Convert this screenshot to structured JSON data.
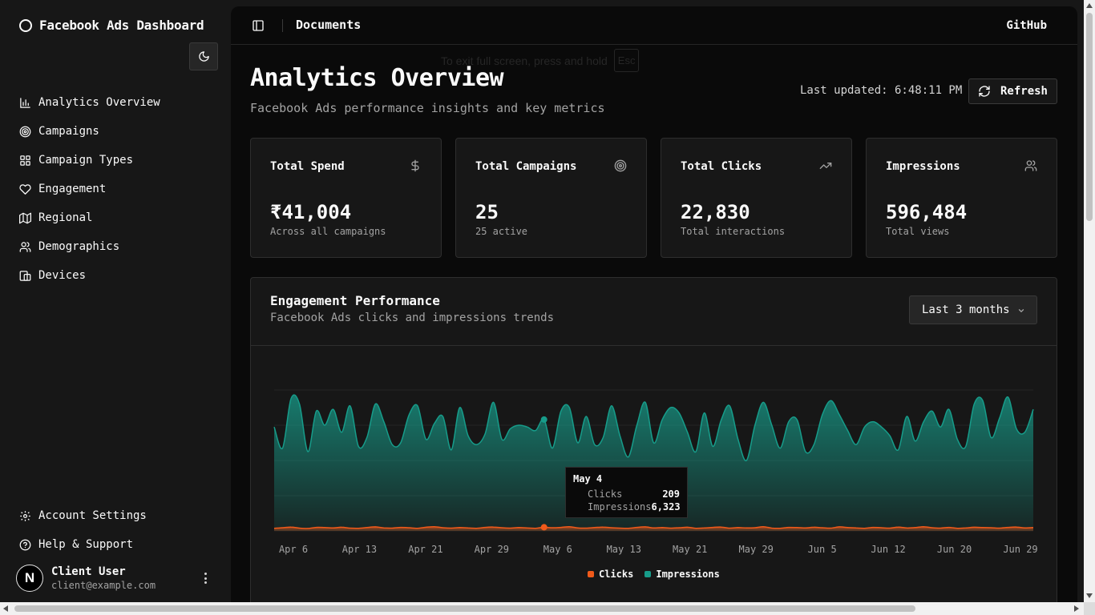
{
  "app": {
    "title": "Facebook Ads Dashboard"
  },
  "sidebar": {
    "items": [
      {
        "label": "Analytics Overview",
        "icon": "bar-chart-icon"
      },
      {
        "label": "Campaigns",
        "icon": "target-icon"
      },
      {
        "label": "Campaign Types",
        "icon": "grid-icon"
      },
      {
        "label": "Engagement",
        "icon": "heart-icon"
      },
      {
        "label": "Regional",
        "icon": "map-icon"
      },
      {
        "label": "Demographics",
        "icon": "users-icon"
      },
      {
        "label": "Devices",
        "icon": "devices-icon"
      }
    ],
    "bottom_items": [
      {
        "label": "Account Settings",
        "icon": "gear-icon"
      },
      {
        "label": "Help & Support",
        "icon": "help-circle-icon"
      }
    ],
    "user": {
      "avatar_letter": "N",
      "name": "Client User",
      "email": "client@example.com"
    }
  },
  "topbar": {
    "title": "Documents",
    "github": "GitHub"
  },
  "fullscreen_hint": {
    "text": "To exit full screen, press and hold",
    "key": "Esc"
  },
  "header": {
    "title": "Analytics Overview",
    "subtitle": "Facebook Ads performance insights and key metrics",
    "last_updated": "Last updated: 6:48:11 PM",
    "refresh_label": "Refresh"
  },
  "cards": [
    {
      "label": "Total Spend",
      "value": "₹41,004",
      "note": "Across all campaigns",
      "icon": "dollar-icon"
    },
    {
      "label": "Total Campaigns",
      "value": "25",
      "note": "25 active",
      "icon": "target-icon"
    },
    {
      "label": "Total Clicks",
      "value": "22,830",
      "note": "Total interactions",
      "icon": "trending-up-icon"
    },
    {
      "label": "Impressions",
      "value": "596,484",
      "note": "Total views",
      "icon": "users-icon"
    }
  ],
  "engagement": {
    "title": "Engagement Performance",
    "subtitle": "Facebook Ads clicks and impressions trends",
    "range": "Last 3 months",
    "tooltip": {
      "date": "May 4",
      "clicks_label": "Clicks",
      "clicks": "209",
      "impressions_label": "Impressions",
      "impressions": "6,323"
    }
  },
  "colors": {
    "clicks": "#f05a1a",
    "impressions": "#179c8a",
    "background": "#0a0a0a",
    "panel": "#171717"
  },
  "chart_data": {
    "type": "area",
    "x_tick_labels": [
      "Apr 6",
      "Apr 13",
      "Apr 21",
      "Apr 29",
      "May 6",
      "May 13",
      "May 21",
      "May 29",
      "Jun 5",
      "Jun 12",
      "Jun 20",
      "Jun 29"
    ],
    "x_range": [
      "Apr 1",
      "Jun 30"
    ],
    "ylim": [
      0,
      8000
    ],
    "grid": "horizontal",
    "legend": "bottom-center",
    "highlight": {
      "date": "May 4",
      "clicks": 209,
      "impressions": 6323
    },
    "series": [
      {
        "name": "Clicks",
        "values": [
          150,
          180,
          220,
          160,
          140,
          200,
          190,
          170,
          210,
          160,
          150,
          190,
          230,
          170,
          160,
          200,
          180,
          150,
          210,
          240,
          180,
          160,
          190,
          170,
          150,
          200,
          220,
          180,
          160,
          190,
          170,
          150,
          209,
          180,
          200,
          240,
          170,
          160,
          190,
          220,
          180,
          160,
          150,
          200,
          230,
          170,
          190,
          160,
          180,
          210,
          150,
          170,
          200,
          220,
          160,
          190,
          170,
          180,
          240,
          160,
          150,
          200,
          190,
          170,
          210,
          180,
          160,
          230,
          190,
          170,
          150,
          200,
          180,
          160,
          220,
          170,
          190,
          240,
          180,
          160,
          200,
          150,
          170,
          210,
          190,
          180,
          160,
          200,
          220,
          170,
          190
        ]
      },
      {
        "name": "Impressions",
        "values": [
          5900,
          4700,
          7500,
          7200,
          4500,
          6800,
          6000,
          6900,
          5600,
          7100,
          4800,
          5300,
          7200,
          6200,
          4900,
          5000,
          6600,
          7100,
          5200,
          6100,
          6500,
          4600,
          7000,
          5400,
          4900,
          5500,
          7300,
          5200,
          5800,
          6000,
          5900,
          5700,
          6323,
          4700,
          6800,
          7000,
          5000,
          6500,
          4900,
          5300,
          7100,
          5400,
          4200,
          6000,
          7300,
          5000,
          6300,
          7000,
          6700,
          5600,
          4500,
          6700,
          4800,
          6300,
          7100,
          5200,
          4000,
          6000,
          7300,
          6000,
          4700,
          6200,
          6300,
          4500,
          4900,
          6600,
          7400,
          6600,
          5700,
          4900,
          5900,
          6200,
          5900,
          5400,
          4600,
          6500,
          5100,
          6200,
          6800,
          5900,
          6900,
          5200,
          4800,
          7200,
          7400,
          5300,
          6400,
          7600,
          5800,
          5600,
          6900
        ]
      }
    ]
  }
}
